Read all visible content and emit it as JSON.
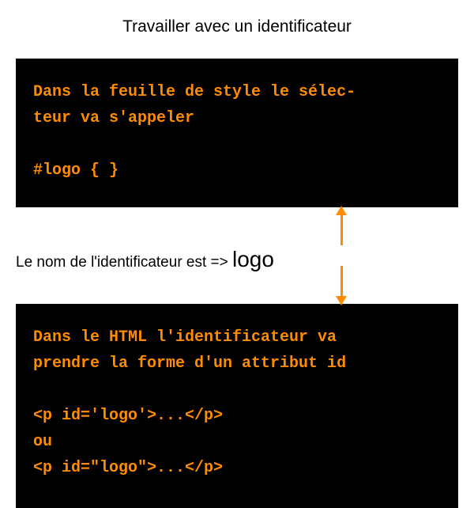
{
  "title": "Travailler avec un identificateur",
  "block1": {
    "text": "Dans la feuille de style le sélec-\nteur va s'appeler\n\n#logo { }"
  },
  "middle": {
    "prefix": "Le nom de l'identificateur est => ",
    "word": "logo"
  },
  "block2": {
    "text": "Dans le HTML l'identificateur va\nprendre la forme d'un attribut id\n\n<p id='logo'>...</p>\nou\n<p id=\"logo\">...</p>"
  }
}
